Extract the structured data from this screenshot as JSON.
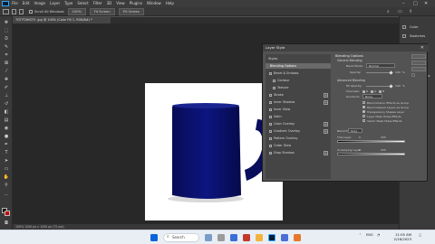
{
  "app": {
    "menus": [
      "File",
      "Edit",
      "Image",
      "Layer",
      "Type",
      "Select",
      "Filter",
      "3D",
      "View",
      "Plugins",
      "Window",
      "Help"
    ]
  },
  "options_bar": {
    "checkbox_label": "Scroll All Windows",
    "zoom": "100%",
    "fit_screen": "Fit Screen",
    "fill_screen": "Fill Screen"
  },
  "document": {
    "tab_title": "7GTYTAMCF5 .jpg @ 100% (Color Fill 1, RGB/8#) *",
    "status": "100%   1200 px x 1200 px (72 ppi)"
  },
  "right_panel": {
    "items": [
      "Color",
      "Swatches",
      "Gradients",
      "Patterns",
      "Properties",
      "Adjustments",
      "Libraries",
      "Layers",
      "Channels",
      "Paths"
    ]
  },
  "dialog": {
    "title": "Layer Style",
    "styles_header": "Styles",
    "styles": [
      {
        "label": "Blending Options",
        "active": true,
        "sub": false,
        "checkbox": false,
        "plus": false
      },
      {
        "label": "Bevel & Emboss",
        "active": false,
        "sub": false,
        "checkbox": true,
        "plus": false
      },
      {
        "label": "Contour",
        "active": false,
        "sub": true,
        "checkbox": true,
        "plus": false
      },
      {
        "label": "Texture",
        "active": false,
        "sub": true,
        "checkbox": true,
        "plus": false
      },
      {
        "label": "Stroke",
        "active": false,
        "sub": false,
        "checkbox": true,
        "plus": true
      },
      {
        "label": "Inner Shadow",
        "active": false,
        "sub": false,
        "checkbox": true,
        "plus": true
      },
      {
        "label": "Inner Glow",
        "active": false,
        "sub": false,
        "checkbox": true,
        "plus": false
      },
      {
        "label": "Satin",
        "active": false,
        "sub": false,
        "checkbox": true,
        "plus": false
      },
      {
        "label": "Color Overlay",
        "active": false,
        "sub": false,
        "checkbox": true,
        "plus": true
      },
      {
        "label": "Gradient Overlay",
        "active": false,
        "sub": false,
        "checkbox": true,
        "plus": true
      },
      {
        "label": "Pattern Overlay",
        "active": false,
        "sub": false,
        "checkbox": true,
        "plus": false
      },
      {
        "label": "Outer Glow",
        "active": false,
        "sub": false,
        "checkbox": true,
        "plus": false
      },
      {
        "label": "Drop Shadow",
        "active": false,
        "sub": false,
        "checkbox": true,
        "plus": true
      }
    ],
    "blending": {
      "heading": "Blending Options",
      "general": "General Blending",
      "blend_mode_label": "Blend Mode:",
      "blend_mode_value": "Normal",
      "opacity_label": "Opacity:",
      "opacity_value": "100",
      "pct": "%",
      "advanced": "Advanced Blending",
      "fill_opacity_label": "Fill Opacity:",
      "fill_opacity_value": "100",
      "channels_label": "Channels:",
      "channel_r": "R",
      "channel_g": "G",
      "channel_b": "B",
      "knockout_label": "Knockout:",
      "knockout_value": "None",
      "cb1": "Blend Interior Effects as Group",
      "cb2": "Blend Clipped Layers as Group",
      "cb3": "Transparency Shapes Layer",
      "cb4": "Layer Mask Hides Effects",
      "cb5": "Vector Mask Hides Effects",
      "blend_if_label": "Blend If:",
      "blend_if_value": "Gray",
      "this_layer": "This Layer:",
      "this_low": "0",
      "this_high": "255",
      "underlying": "Underlying Layer:",
      "under_low": "0",
      "under_high": "255"
    }
  },
  "taskbar": {
    "search": "Search",
    "lang": "ENG",
    "time": "11:05 AM",
    "date": "2/16/2023"
  },
  "colors": {
    "mug": "#0b1270",
    "foreground": "#000000",
    "background_swatch": "#cc0000"
  }
}
